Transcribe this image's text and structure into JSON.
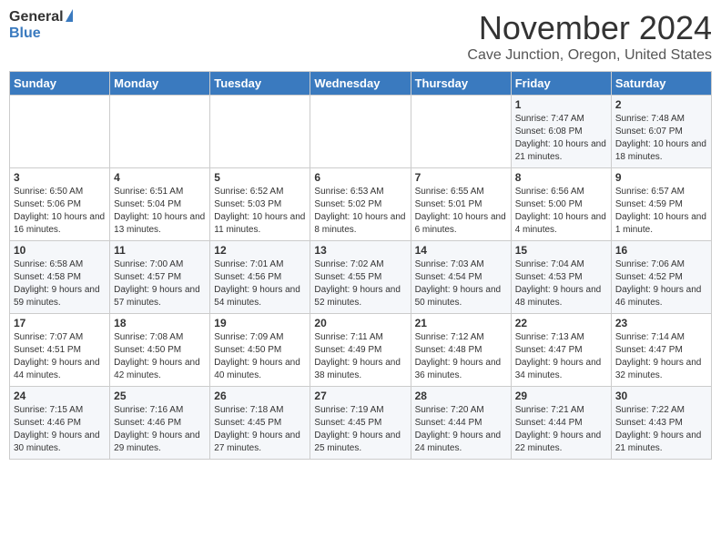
{
  "header": {
    "logo_general": "General",
    "logo_blue": "Blue",
    "month_title": "November 2024",
    "subtitle": "Cave Junction, Oregon, United States"
  },
  "weekdays": [
    "Sunday",
    "Monday",
    "Tuesday",
    "Wednesday",
    "Thursday",
    "Friday",
    "Saturday"
  ],
  "weeks": [
    [
      {
        "day": "",
        "sunrise": "",
        "sunset": "",
        "daylight": ""
      },
      {
        "day": "",
        "sunrise": "",
        "sunset": "",
        "daylight": ""
      },
      {
        "day": "",
        "sunrise": "",
        "sunset": "",
        "daylight": ""
      },
      {
        "day": "",
        "sunrise": "",
        "sunset": "",
        "daylight": ""
      },
      {
        "day": "",
        "sunrise": "",
        "sunset": "",
        "daylight": ""
      },
      {
        "day": "1",
        "sunrise": "Sunrise: 7:47 AM",
        "sunset": "Sunset: 6:08 PM",
        "daylight": "Daylight: 10 hours and 21 minutes."
      },
      {
        "day": "2",
        "sunrise": "Sunrise: 7:48 AM",
        "sunset": "Sunset: 6:07 PM",
        "daylight": "Daylight: 10 hours and 18 minutes."
      }
    ],
    [
      {
        "day": "3",
        "sunrise": "Sunrise: 6:50 AM",
        "sunset": "Sunset: 5:06 PM",
        "daylight": "Daylight: 10 hours and 16 minutes."
      },
      {
        "day": "4",
        "sunrise": "Sunrise: 6:51 AM",
        "sunset": "Sunset: 5:04 PM",
        "daylight": "Daylight: 10 hours and 13 minutes."
      },
      {
        "day": "5",
        "sunrise": "Sunrise: 6:52 AM",
        "sunset": "Sunset: 5:03 PM",
        "daylight": "Daylight: 10 hours and 11 minutes."
      },
      {
        "day": "6",
        "sunrise": "Sunrise: 6:53 AM",
        "sunset": "Sunset: 5:02 PM",
        "daylight": "Daylight: 10 hours and 8 minutes."
      },
      {
        "day": "7",
        "sunrise": "Sunrise: 6:55 AM",
        "sunset": "Sunset: 5:01 PM",
        "daylight": "Daylight: 10 hours and 6 minutes."
      },
      {
        "day": "8",
        "sunrise": "Sunrise: 6:56 AM",
        "sunset": "Sunset: 5:00 PM",
        "daylight": "Daylight: 10 hours and 4 minutes."
      },
      {
        "day": "9",
        "sunrise": "Sunrise: 6:57 AM",
        "sunset": "Sunset: 4:59 PM",
        "daylight": "Daylight: 10 hours and 1 minute."
      }
    ],
    [
      {
        "day": "10",
        "sunrise": "Sunrise: 6:58 AM",
        "sunset": "Sunset: 4:58 PM",
        "daylight": "Daylight: 9 hours and 59 minutes."
      },
      {
        "day": "11",
        "sunrise": "Sunrise: 7:00 AM",
        "sunset": "Sunset: 4:57 PM",
        "daylight": "Daylight: 9 hours and 57 minutes."
      },
      {
        "day": "12",
        "sunrise": "Sunrise: 7:01 AM",
        "sunset": "Sunset: 4:56 PM",
        "daylight": "Daylight: 9 hours and 54 minutes."
      },
      {
        "day": "13",
        "sunrise": "Sunrise: 7:02 AM",
        "sunset": "Sunset: 4:55 PM",
        "daylight": "Daylight: 9 hours and 52 minutes."
      },
      {
        "day": "14",
        "sunrise": "Sunrise: 7:03 AM",
        "sunset": "Sunset: 4:54 PM",
        "daylight": "Daylight: 9 hours and 50 minutes."
      },
      {
        "day": "15",
        "sunrise": "Sunrise: 7:04 AM",
        "sunset": "Sunset: 4:53 PM",
        "daylight": "Daylight: 9 hours and 48 minutes."
      },
      {
        "day": "16",
        "sunrise": "Sunrise: 7:06 AM",
        "sunset": "Sunset: 4:52 PM",
        "daylight": "Daylight: 9 hours and 46 minutes."
      }
    ],
    [
      {
        "day": "17",
        "sunrise": "Sunrise: 7:07 AM",
        "sunset": "Sunset: 4:51 PM",
        "daylight": "Daylight: 9 hours and 44 minutes."
      },
      {
        "day": "18",
        "sunrise": "Sunrise: 7:08 AM",
        "sunset": "Sunset: 4:50 PM",
        "daylight": "Daylight: 9 hours and 42 minutes."
      },
      {
        "day": "19",
        "sunrise": "Sunrise: 7:09 AM",
        "sunset": "Sunset: 4:50 PM",
        "daylight": "Daylight: 9 hours and 40 minutes."
      },
      {
        "day": "20",
        "sunrise": "Sunrise: 7:11 AM",
        "sunset": "Sunset: 4:49 PM",
        "daylight": "Daylight: 9 hours and 38 minutes."
      },
      {
        "day": "21",
        "sunrise": "Sunrise: 7:12 AM",
        "sunset": "Sunset: 4:48 PM",
        "daylight": "Daylight: 9 hours and 36 minutes."
      },
      {
        "day": "22",
        "sunrise": "Sunrise: 7:13 AM",
        "sunset": "Sunset: 4:47 PM",
        "daylight": "Daylight: 9 hours and 34 minutes."
      },
      {
        "day": "23",
        "sunrise": "Sunrise: 7:14 AM",
        "sunset": "Sunset: 4:47 PM",
        "daylight": "Daylight: 9 hours and 32 minutes."
      }
    ],
    [
      {
        "day": "24",
        "sunrise": "Sunrise: 7:15 AM",
        "sunset": "Sunset: 4:46 PM",
        "daylight": "Daylight: 9 hours and 30 minutes."
      },
      {
        "day": "25",
        "sunrise": "Sunrise: 7:16 AM",
        "sunset": "Sunset: 4:46 PM",
        "daylight": "Daylight: 9 hours and 29 minutes."
      },
      {
        "day": "26",
        "sunrise": "Sunrise: 7:18 AM",
        "sunset": "Sunset: 4:45 PM",
        "daylight": "Daylight: 9 hours and 27 minutes."
      },
      {
        "day": "27",
        "sunrise": "Sunrise: 7:19 AM",
        "sunset": "Sunset: 4:45 PM",
        "daylight": "Daylight: 9 hours and 25 minutes."
      },
      {
        "day": "28",
        "sunrise": "Sunrise: 7:20 AM",
        "sunset": "Sunset: 4:44 PM",
        "daylight": "Daylight: 9 hours and 24 minutes."
      },
      {
        "day": "29",
        "sunrise": "Sunrise: 7:21 AM",
        "sunset": "Sunset: 4:44 PM",
        "daylight": "Daylight: 9 hours and 22 minutes."
      },
      {
        "day": "30",
        "sunrise": "Sunrise: 7:22 AM",
        "sunset": "Sunset: 4:43 PM",
        "daylight": "Daylight: 9 hours and 21 minutes."
      }
    ]
  ]
}
